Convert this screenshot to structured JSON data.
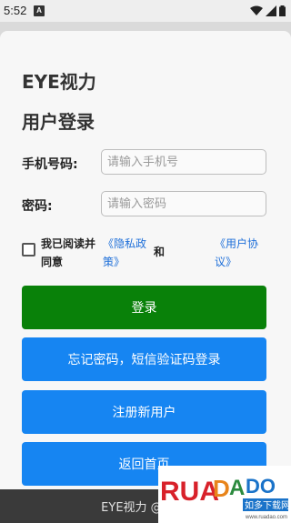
{
  "status_bar": {
    "time": "5:52",
    "badge": "A"
  },
  "app": {
    "title": "EYE视力"
  },
  "login": {
    "heading": "用户登录",
    "phone_label": "手机号码:",
    "phone_placeholder": "请输入手机号",
    "phone_value": "",
    "password_label": "密码:",
    "password_placeholder": "请输入密码",
    "password_value": ""
  },
  "agreement": {
    "text": "我已阅读并同意",
    "privacy_link": "《隐私政策》",
    "and": "和",
    "terms_link": "《用户协议》",
    "checked": false
  },
  "buttons": {
    "login": "登录",
    "forgot": "忘记密码，短信验证码登录",
    "register": "注册新用户",
    "home": "返回首页"
  },
  "footer": {
    "text": "EYE视力 @ 最行"
  },
  "watermark": {
    "brand": "RUANDADO",
    "sub": "如多下载网",
    "url": "www.ruadao.com"
  },
  "colors": {
    "login_button": "#098109",
    "blue_button": "#1685f2",
    "link": "#1e6fd9",
    "footer_bg": "#3a3a3a"
  }
}
